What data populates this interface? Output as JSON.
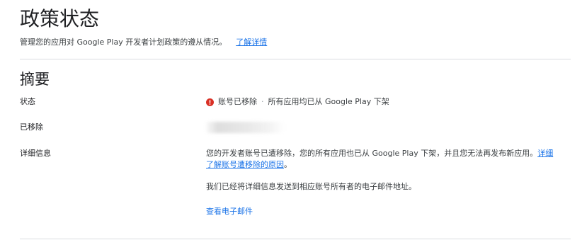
{
  "header": {
    "title": "政策状态",
    "subtitle": "管理您的应用对 Google Play 开发者计划政策的遵从情况。",
    "learn_more_link": "了解详情"
  },
  "summary": {
    "title": "摘要",
    "status_label": "状态",
    "status_icon": "error-icon",
    "status_icon_color": "#d93025",
    "status_text": "账号已移除",
    "status_separator": "·",
    "status_detail": "所有应用均已从 Google Play 下架",
    "removed_label": "已移除",
    "details_label": "详细信息",
    "details_text": "您的开发者账号已遭移除，您的所有应用也已从 Google Play 下架，并且您无法再发布新应用。",
    "details_link": "详细了解账号遭移除的原因",
    "details_link_suffix": "。",
    "email_notice": "我们已经将详细信息发送到相应账号所有者的电子邮件地址。",
    "view_email_link": "查看电子邮件"
  },
  "colors": {
    "link": "#1a73e8",
    "divider": "#dadce0",
    "text": "#202124"
  }
}
